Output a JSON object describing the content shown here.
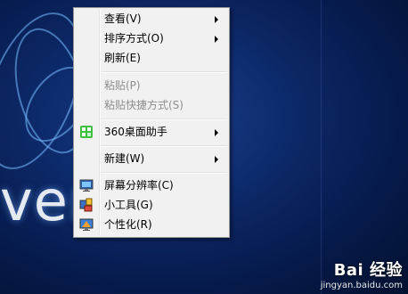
{
  "wallpaper": {
    "text": "ver"
  },
  "context_menu": {
    "view": {
      "label": "查看(V)",
      "icon": ""
    },
    "sort": {
      "label": "排序方式(O)"
    },
    "refresh": {
      "label": "刷新(E)"
    },
    "paste": {
      "label": "粘贴(P)"
    },
    "paste_shortcut": {
      "label": "粘贴快捷方式(S)"
    },
    "desk_helper": {
      "label": "360桌面助手",
      "icon": "360-desktop-helper-icon"
    },
    "new": {
      "label": "新建(W)"
    },
    "resolution": {
      "label": "屏幕分辨率(C)",
      "icon": "screen-resolution-icon"
    },
    "gadgets": {
      "label": "小工具(G)",
      "icon": "gadgets-icon"
    },
    "personalize": {
      "label": "个性化(R)",
      "icon": "personalize-icon"
    }
  },
  "watermark": {
    "brand": "Bai 经验",
    "url": "jingyan.baidu.com"
  }
}
